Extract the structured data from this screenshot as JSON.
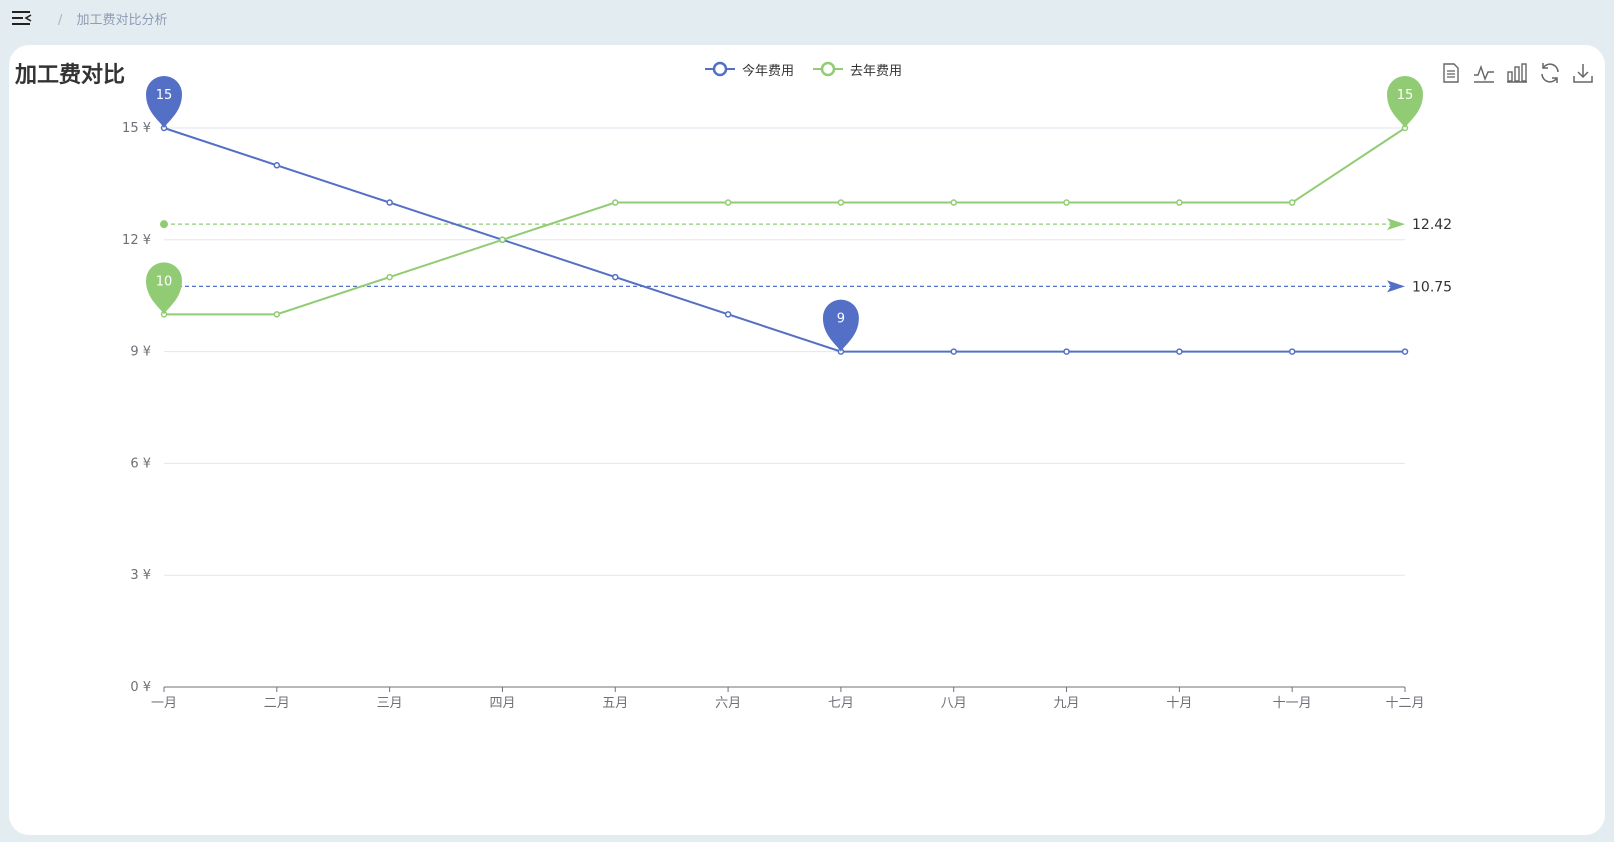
{
  "nav": {
    "separator": "/",
    "breadcrumb": "加工费对比分析"
  },
  "card": {
    "title": "加工费对比"
  },
  "toolbox": [
    "data-view",
    "line-chart",
    "bar-chart",
    "restore",
    "save-image"
  ],
  "chart_data": {
    "type": "line",
    "categories": [
      "一月",
      "二月",
      "三月",
      "四月",
      "五月",
      "六月",
      "七月",
      "八月",
      "九月",
      "十月",
      "十一月",
      "十二月"
    ],
    "series": [
      {
        "name": "今年费用",
        "color": "#5470c6",
        "values": [
          15,
          14,
          13,
          12,
          11,
          10,
          9,
          9,
          9,
          9,
          9,
          9
        ],
        "mark_points": [
          {
            "index": 0,
            "value": 15
          },
          {
            "index": 6,
            "value": 9
          }
        ],
        "mark_line_average": 10.75
      },
      {
        "name": "去年费用",
        "color": "#91cc75",
        "values": [
          10,
          10,
          11,
          12,
          13,
          13,
          13,
          13,
          13,
          13,
          13,
          15
        ],
        "mark_points": [
          {
            "index": 0,
            "value": 10
          },
          {
            "index": 11,
            "value": 15
          }
        ],
        "mark_line_average": 12.42
      }
    ],
    "yaxis": {
      "ticks": [
        "0 ¥",
        "3 ¥",
        "6 ¥",
        "9 ¥",
        "12 ¥",
        "15 ¥"
      ],
      "min": 0,
      "max": 15,
      "interval": 3
    },
    "grid": true,
    "legend": "top-center"
  }
}
